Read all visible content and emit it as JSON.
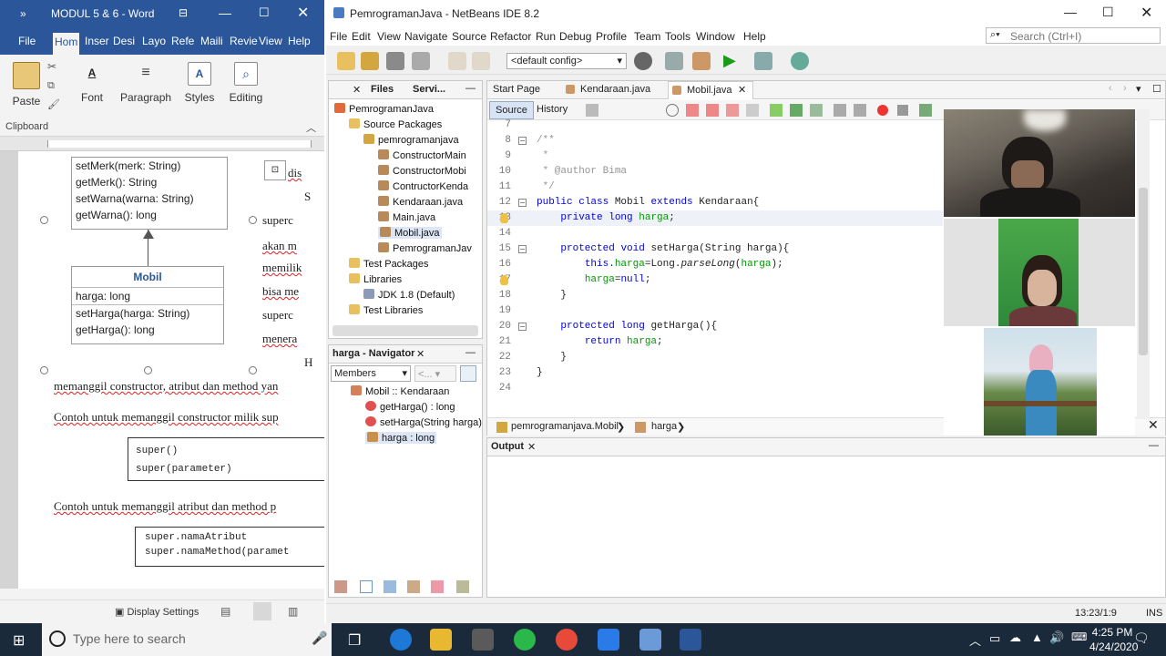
{
  "word": {
    "title": "MODUL 5 & 6 - Word",
    "tabs": [
      "File",
      "Hom",
      "Inser",
      "Desi",
      "Layo",
      "Refe",
      "Maili",
      "Revie",
      "View",
      "Help"
    ],
    "ribbon": {
      "paste": "Paste",
      "clipboard": "Clipboard",
      "font": "Font",
      "paragraph": "Paragraph",
      "styles": "Styles",
      "editing": "Editing"
    },
    "uml_top": [
      "setMerk(merk: String)",
      "getMerk(): String",
      "setWarna(warna: String)",
      "getWarna(): long"
    ],
    "uml_mobil": {
      "name": "Mobil",
      "attr": "harga: long",
      "methods": [
        "setHarga(harga: String)",
        "getHarga(): long"
      ]
    },
    "side_text": [
      "superc",
      "akan m",
      "memilik",
      "bisa me",
      "superc",
      "menera"
    ],
    "side_fragments": [
      "dis",
      "S",
      "H"
    ],
    "para1": "memanggil constructor, atribut dan method yan",
    "para2": "Contoh untuk memanggil constructor milik sup",
    "code1": [
      "super()",
      "super(parameter)"
    ],
    "para3": "Contoh untuk memanggil atribut dan method p",
    "code2": [
      "super.namaAtribut",
      "super.namaMethod(paramet"
    ],
    "status": "Display Settings"
  },
  "netbeans": {
    "title": "PemrogramanJava - NetBeans IDE 8.2",
    "menu": [
      "File",
      "Edit",
      "View",
      "Navigate",
      "Source",
      "Refactor",
      "Run",
      "Debug",
      "Profile",
      "Team",
      "Tools",
      "Window",
      "Help"
    ],
    "search_placeholder": "Search (Ctrl+I)",
    "config": "<default config>",
    "panel_tabs": [
      "Files",
      "Servi..."
    ],
    "project_tree": [
      {
        "label": "PemrogramanJava",
        "level": 0,
        "icon": "project"
      },
      {
        "label": "Source Packages",
        "level": 1,
        "icon": "folder"
      },
      {
        "label": "pemrogramanjava",
        "level": 2,
        "icon": "package"
      },
      {
        "label": "ConstructorMain",
        "level": 3,
        "icon": "java"
      },
      {
        "label": "ConstructorMobi",
        "level": 3,
        "icon": "java"
      },
      {
        "label": "ContructorKenda",
        "level": 3,
        "icon": "java"
      },
      {
        "label": "Kendaraan.java",
        "level": 3,
        "icon": "java"
      },
      {
        "label": "Main.java",
        "level": 3,
        "icon": "java"
      },
      {
        "label": "Mobil.java",
        "level": 3,
        "icon": "java"
      },
      {
        "label": "PemrogramanJav",
        "level": 3,
        "icon": "java"
      },
      {
        "label": "Test Packages",
        "level": 1,
        "icon": "folder"
      },
      {
        "label": "Libraries",
        "level": 1,
        "icon": "folder"
      },
      {
        "label": "JDK 1.8 (Default)",
        "level": 2,
        "icon": "jdk"
      },
      {
        "label": "Test Libraries",
        "level": 1,
        "icon": "folder"
      }
    ],
    "navigator_title": "harga - Navigator",
    "navigator_filter": "Members",
    "navigator_tree": [
      {
        "label": "Mobil :: Kendaraan",
        "level": 0
      },
      {
        "label": "getHarga() : long",
        "level": 1
      },
      {
        "label": "setHarga(String harga)",
        "level": 1
      },
      {
        "label": "harga : long",
        "level": 1
      }
    ],
    "editor_tabs": [
      "Start Page",
      "Kendaraan.java",
      "Mobil.java"
    ],
    "source_tab": "Source",
    "history_tab": "History",
    "code_lines": [
      {
        "n": "7",
        "t": ""
      },
      {
        "n": "8",
        "t": "/**"
      },
      {
        "n": "9",
        "t": " *"
      },
      {
        "n": "10",
        "t": " * @author Bima"
      },
      {
        "n": "11",
        "t": " */"
      },
      {
        "n": "12",
        "t": "public class Mobil extends Kendaraan{"
      },
      {
        "n": "13",
        "t": "    private long harga;"
      },
      {
        "n": "14",
        "t": ""
      },
      {
        "n": "15",
        "t": "    protected void setHarga(String harga){"
      },
      {
        "n": "16",
        "t": "        this.harga=Long.parseLong(harga);"
      },
      {
        "n": "17",
        "t": "        harga=null;"
      },
      {
        "n": "18",
        "t": "    }"
      },
      {
        "n": "19",
        "t": ""
      },
      {
        "n": "20",
        "t": "    protected long getHarga(){"
      },
      {
        "n": "21",
        "t": "        return harga;"
      },
      {
        "n": "22",
        "t": "    }"
      },
      {
        "n": "23",
        "t": "}"
      },
      {
        "n": "24",
        "t": ""
      }
    ],
    "breadcrumb": [
      "pemrogramanjava.Mobil",
      "harga"
    ],
    "output_tab": "Output",
    "status_pos": "13:23/1:9",
    "status_mode": "INS"
  },
  "taskbar": {
    "search_placeholder": "Type here to search",
    "time": "4:25 PM",
    "date": "4/24/2020"
  }
}
